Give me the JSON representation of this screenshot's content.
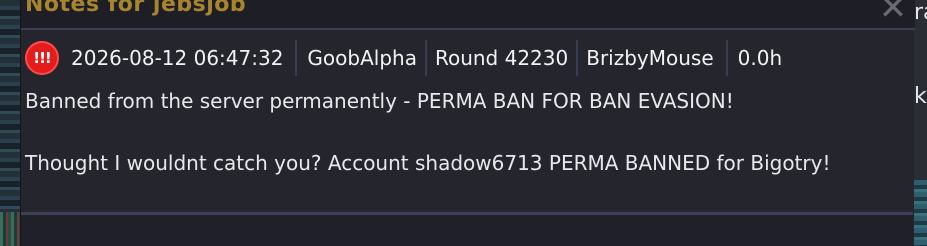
{
  "window": {
    "title": "Notes for jebsjob"
  },
  "note": {
    "severity_icon_text": "!!!",
    "timestamp": "2026-08-12 06:47:32",
    "server": "GoobAlpha",
    "round": "Round 42230",
    "author": "BrizbyMouse",
    "playtime": "0.0h",
    "body_line_1": "Banned from the server permanently - PERMA BAN FOR BAN EVASION!",
    "body_line_2": "Thought I wouldnt catch you? Account shadow6713 PERMA BANNED for Bigotry!"
  },
  "background": {
    "right_text_top": "ra",
    "right_text_mid": "k"
  },
  "colors": {
    "title": "#a8852c",
    "alert": "#e31c1c",
    "text": "#e8e8ec",
    "window_bg": "#25252e",
    "separator": "#3b3e56"
  }
}
